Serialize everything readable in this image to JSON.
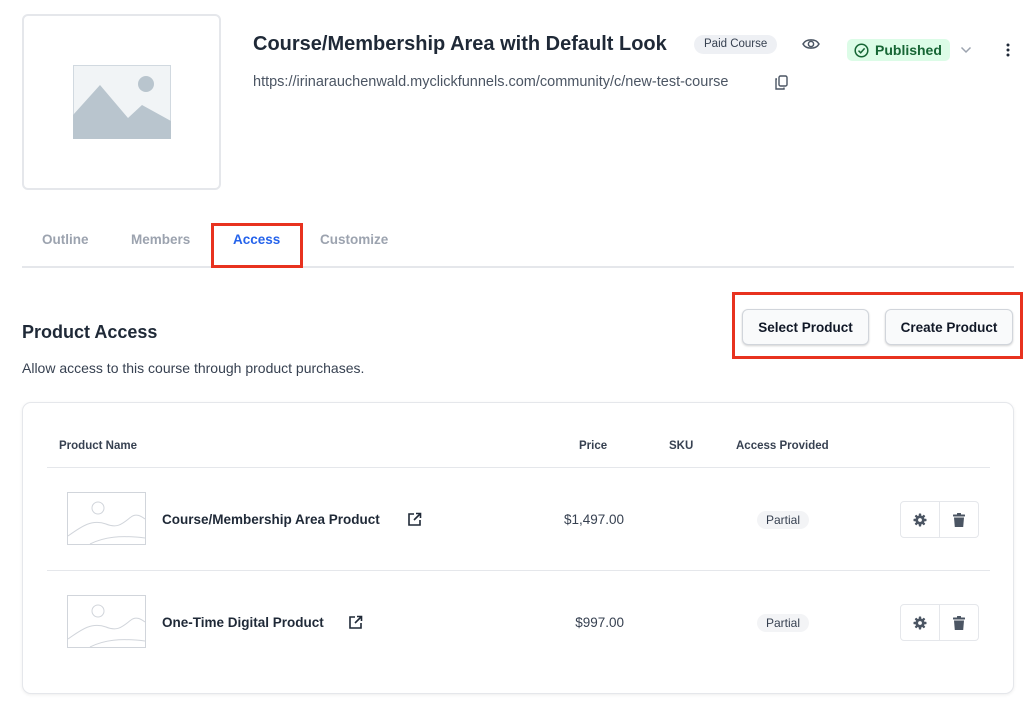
{
  "course": {
    "title": "Course/Membership Area with Default Look",
    "type_badge": "Paid Course",
    "status": "Published",
    "url": "https://irinarauchenwald.myclickfunnels.com/community/c/new-test-course"
  },
  "tabs": [
    {
      "label": "Outline",
      "active": false
    },
    {
      "label": "Members",
      "active": false
    },
    {
      "label": "Access",
      "active": true
    },
    {
      "label": "Customize",
      "active": false
    }
  ],
  "product_access": {
    "title": "Product Access",
    "description": "Allow access to this course through product purchases.",
    "select_button": "Select Product",
    "create_button": "Create Product"
  },
  "table": {
    "columns": {
      "name": "Product Name",
      "price": "Price",
      "sku": "SKU",
      "access": "Access Provided"
    },
    "rows": [
      {
        "name": "Course/Membership Area Product",
        "price": "$1,497.00",
        "sku": "",
        "access": "Partial"
      },
      {
        "name": "One-Time Digital Product",
        "price": "$997.00",
        "sku": "",
        "access": "Partial"
      }
    ]
  },
  "colors": {
    "accent": "#2563eb",
    "published_bg": "#dcfce7",
    "published_text": "#166534",
    "highlight": "#e8321f"
  },
  "icons": [
    "image-placeholder-icon",
    "eye-icon",
    "check-circle-icon",
    "chevron-down-icon",
    "kebab-icon",
    "copy-icon",
    "external-link-icon",
    "gear-icon",
    "trash-icon"
  ]
}
